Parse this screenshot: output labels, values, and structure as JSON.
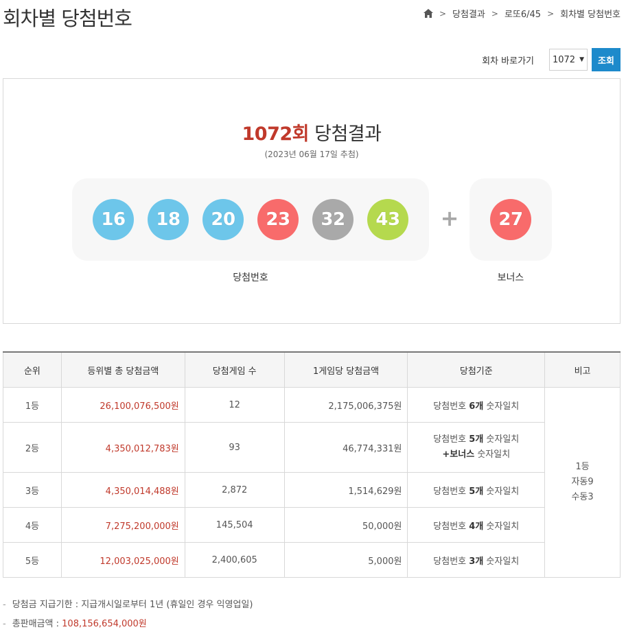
{
  "page": {
    "title": "회차별 당첨번호"
  },
  "breadcrumb": {
    "items": [
      "당첨결과",
      "로또6/45",
      "회차별 당첨번호"
    ]
  },
  "goto": {
    "label": "회차 바로가기",
    "selected_round": "1072",
    "button_label": "조회"
  },
  "result": {
    "round_number": "1072회",
    "title_suffix": "당첨결과",
    "draw_date": "(2023년 06월 17일 추첨)",
    "winning_label": "당첨번호",
    "bonus_label": "보너스",
    "plus": "+",
    "balls": [
      {
        "number": "16",
        "color": "#6dc6ea"
      },
      {
        "number": "18",
        "color": "#6dc6ea"
      },
      {
        "number": "20",
        "color": "#6dc6ea"
      },
      {
        "number": "23",
        "color": "#f86b6b"
      },
      {
        "number": "32",
        "color": "#a9a9a9"
      },
      {
        "number": "43",
        "color": "#b5d94e"
      }
    ],
    "bonus_ball": {
      "number": "27",
      "color": "#f86b6b"
    }
  },
  "table": {
    "headers": [
      "순위",
      "등위별 총 당첨금액",
      "당첨게임 수",
      "1게임당 당첨금액",
      "당첨기준",
      "비고"
    ],
    "rows": [
      {
        "rank": "1등",
        "total": "26,100,076,500원",
        "games": "12",
        "per_game": "2,175,006,375원",
        "criteria_pre": "당첨번호 ",
        "criteria_bold": "6개",
        "criteria_post": " 숫자일치"
      },
      {
        "rank": "2등",
        "total": "4,350,012,783원",
        "games": "93",
        "per_game": "46,774,331원",
        "criteria_pre": "당첨번호 ",
        "criteria_bold": "5개",
        "criteria_post": " 숫자일치",
        "criteria2_bold": "+보너스",
        "criteria2_post": " 숫자일치"
      },
      {
        "rank": "3등",
        "total": "4,350,014,488원",
        "games": "2,872",
        "per_game": "1,514,629원",
        "criteria_pre": "당첨번호 ",
        "criteria_bold": "5개",
        "criteria_post": " 숫자일치"
      },
      {
        "rank": "4등",
        "total": "7,275,200,000원",
        "games": "145,504",
        "per_game": "50,000원",
        "criteria_pre": "당첨번호 ",
        "criteria_bold": "4개",
        "criteria_post": " 숫자일치"
      },
      {
        "rank": "5등",
        "total": "12,003,025,000원",
        "games": "2,400,605",
        "per_game": "5,000원",
        "criteria_pre": "당첨번호 ",
        "criteria_bold": "3개",
        "criteria_post": " 숫자일치"
      }
    ],
    "remarks": [
      "1등",
      "자동9",
      "수동3"
    ]
  },
  "notes": {
    "deadline": "당첨금 지급기한 : 지급개시일로부터 1년 (휴일인 경우 익영업일)",
    "sales_label": "총판매금액 : ",
    "sales_value": "108,156,654,000원"
  }
}
